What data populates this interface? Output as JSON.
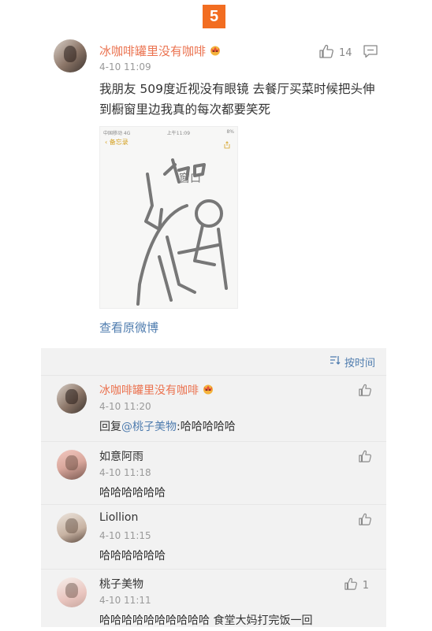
{
  "badge": "5",
  "post": {
    "username": "冰咖啡罐里没有咖啡",
    "time": "4-10 11:09",
    "like_count": "14",
    "text": "我朋友 509度近视没有眼镜 去餐厅买菜时候把头伸到橱窗里边我真的每次都要笑死",
    "image": {
      "status_left": "中国移动 4G",
      "status_center": "上午11:09",
      "status_right": "8%",
      "back_label": "备忘录",
      "sketch_label": "窗口"
    },
    "view_original": "查看原微博"
  },
  "comments": {
    "sort_label": "按时间",
    "items": [
      {
        "username": "冰咖啡罐里没有咖啡",
        "time": "4-10 11:20",
        "reply_prefix": "回复",
        "mention": "@桃子美物",
        "text": ":哈哈哈哈哈",
        "like_count": ""
      },
      {
        "username": "如意阿雨",
        "time": "4-10 11:18",
        "text": "哈哈哈哈哈哈",
        "like_count": ""
      },
      {
        "username": "Liollion",
        "time": "4-10 11:15",
        "text": "哈哈哈哈哈哈",
        "like_count": ""
      },
      {
        "username": "桃子美物",
        "time": "4-10 11:11",
        "text": "哈哈哈哈哈哈哈哈哈哈 食堂大妈打完饭一回",
        "like_count": "1"
      }
    ]
  },
  "colors": {
    "username": "#eb7350",
    "link": "#507daf",
    "badge": "#f26d21",
    "comment_bg": "#f2f2f2"
  }
}
